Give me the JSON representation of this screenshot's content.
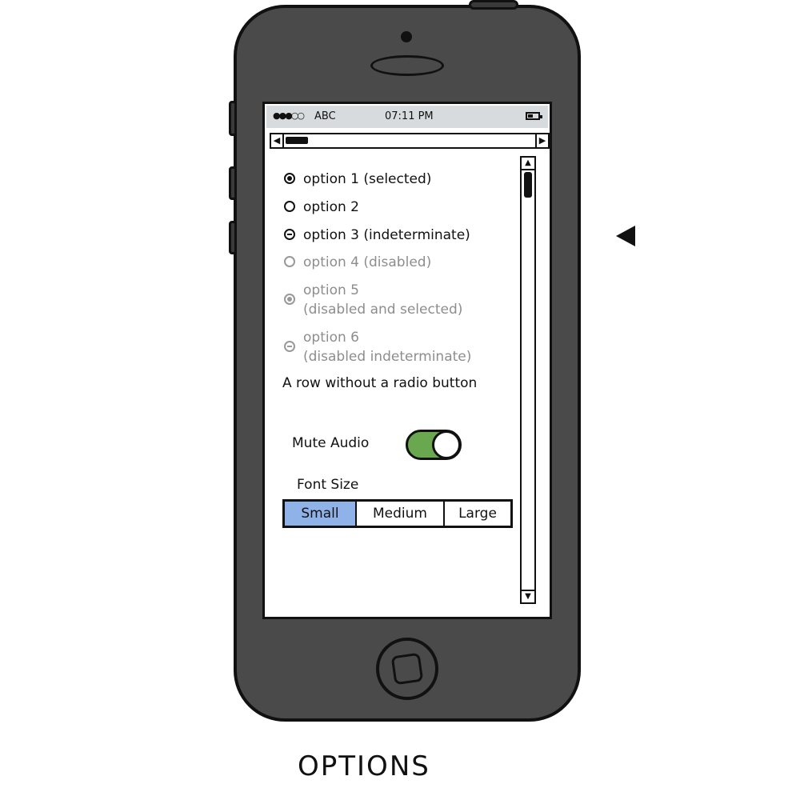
{
  "statusbar": {
    "signal": "●●●○○",
    "carrier": "ABC",
    "time": "07:11 PM",
    "battery_icon": "battery-icon"
  },
  "hscroll": {
    "left_arrow": "◀",
    "right_arrow": "▶"
  },
  "vscroll": {
    "up_arrow": "▲",
    "down_arrow": "▼"
  },
  "options": [
    {
      "line1": "option 1 (selected)",
      "line2": "",
      "state": "selected",
      "disabled": false
    },
    {
      "line1": "option 2",
      "line2": "",
      "state": "unselected",
      "disabled": false
    },
    {
      "line1": "option 3 (indeterminate)",
      "line2": "",
      "state": "indeterminate",
      "disabled": false
    },
    {
      "line1": "option 4 (disabled)",
      "line2": "",
      "state": "unselected",
      "disabled": true
    },
    {
      "line1": "option 5",
      "line2": "(disabled and selected)",
      "state": "selected",
      "disabled": true
    },
    {
      "line1": "option 6",
      "line2": "(disabled indeterminate)",
      "state": "indeterminate",
      "disabled": true
    }
  ],
  "plain_row": "A row without a radio button",
  "mute": {
    "label": "Mute Audio",
    "on": true,
    "color": "#6aa84f"
  },
  "font_size": {
    "label": "Font Size",
    "segments": [
      "Small",
      "Medium",
      "Large"
    ],
    "selected": "Small",
    "accent": "#8fb3e8"
  },
  "caption": "OPTIONS"
}
